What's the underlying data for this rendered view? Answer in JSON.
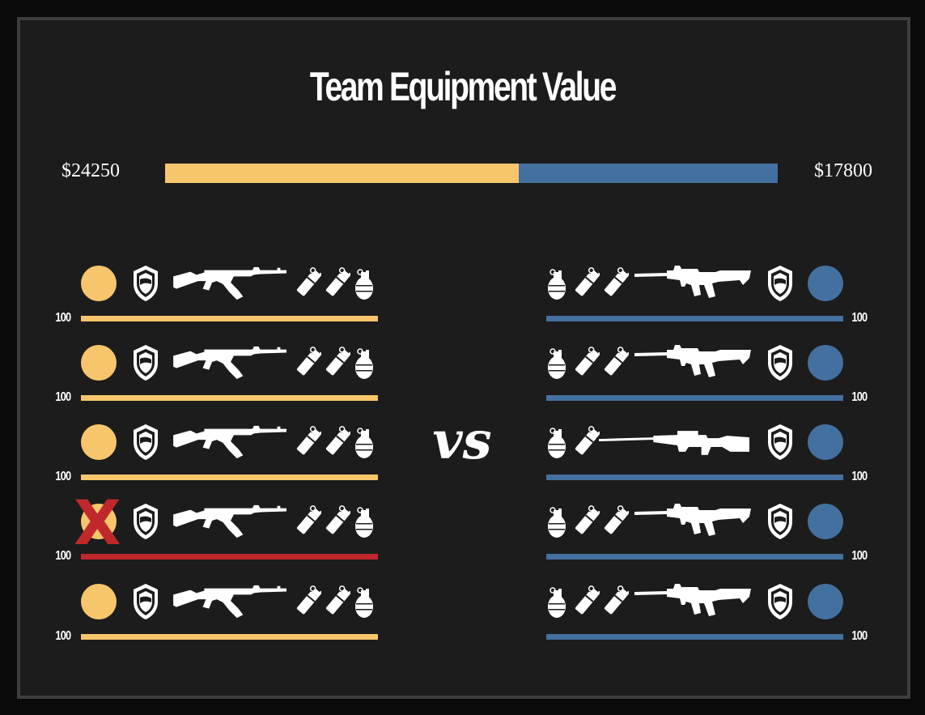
{
  "header": {
    "title": "Team Equipment Value"
  },
  "teams": {
    "left": {
      "value_label": "$24250",
      "value": 24250,
      "color": "#f7c56b"
    },
    "right": {
      "value_label": "$17800",
      "value": 17800,
      "color": "#43709f"
    }
  },
  "vs_label": "vs",
  "dead_color": "#c0282c",
  "left_players": [
    {
      "hp": "100",
      "alive": true,
      "armor_icon": "shield-icon",
      "weapon_icon": "ak47-icon",
      "utility": [
        "flashbang-icon",
        "flashbang-icon",
        "grenade-icon"
      ]
    },
    {
      "hp": "100",
      "alive": true,
      "armor_icon": "shield-icon",
      "weapon_icon": "ak47-icon",
      "utility": [
        "flashbang-icon",
        "flashbang-icon",
        "grenade-icon"
      ]
    },
    {
      "hp": "100",
      "alive": true,
      "armor_icon": "shield-icon",
      "weapon_icon": "ak47-icon",
      "utility": [
        "flashbang-icon",
        "flashbang-icon",
        "grenade-icon"
      ]
    },
    {
      "hp": "100",
      "alive": false,
      "dead_mark": "X",
      "armor_icon": "shield-icon",
      "weapon_icon": "ak47-icon",
      "utility": [
        "flashbang-icon",
        "flashbang-icon",
        "grenade-icon"
      ]
    },
    {
      "hp": "100",
      "alive": true,
      "armor_icon": "shield-icon",
      "weapon_icon": "ak47-icon",
      "utility": [
        "flashbang-icon",
        "flashbang-icon",
        "grenade-icon"
      ]
    }
  ],
  "right_players": [
    {
      "hp": "100",
      "alive": true,
      "armor_icon": "shield-icon",
      "weapon_icon": "m4-rifle-icon",
      "utility": [
        "grenade-icon",
        "flashbang-icon",
        "flashbang-icon"
      ]
    },
    {
      "hp": "100",
      "alive": true,
      "armor_icon": "shield-icon",
      "weapon_icon": "m4-rifle-icon",
      "utility": [
        "grenade-icon",
        "flashbang-icon",
        "flashbang-icon"
      ]
    },
    {
      "hp": "100",
      "alive": true,
      "armor_icon": "shield-icon",
      "weapon_icon": "sniper-rifle-icon",
      "utility": [
        "grenade-icon",
        "flashbang-icon"
      ]
    },
    {
      "hp": "100",
      "alive": true,
      "armor_icon": "shield-icon",
      "weapon_icon": "m4-rifle-icon",
      "utility": [
        "grenade-icon",
        "flashbang-icon",
        "flashbang-icon"
      ]
    },
    {
      "hp": "100",
      "alive": true,
      "armor_icon": "shield-icon",
      "weapon_icon": "m4-rifle-icon",
      "utility": [
        "grenade-icon",
        "flashbang-icon",
        "flashbang-icon"
      ]
    }
  ]
}
